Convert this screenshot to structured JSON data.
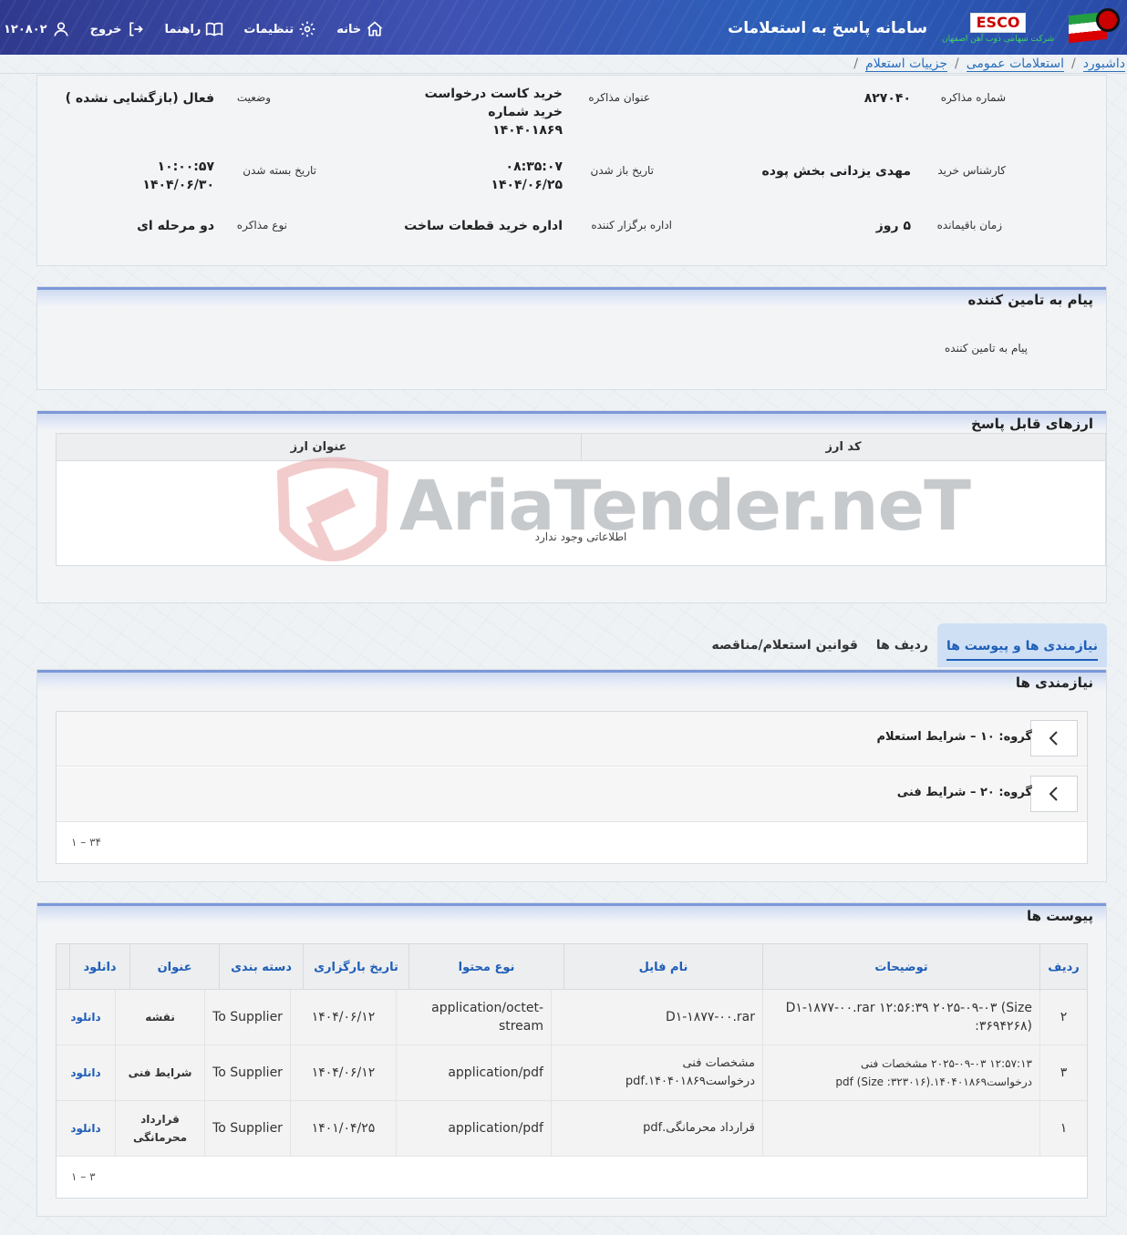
{
  "header": {
    "system_title": "سامانه پاسخ به استعلامات",
    "brand_name": "ESCO",
    "brand_sub": "شرکت سهامی ذوب آهن اصفهان",
    "nav": {
      "home": "خانه",
      "settings": "تنظیمات",
      "guide": "راهنما",
      "logout": "خروج",
      "user_id": "۱۲۰۸۰۲"
    }
  },
  "breadcrumb": {
    "items": [
      "داشبورد",
      "استعلامات عمومی",
      "جزییات استعلام"
    ],
    "separator": "/"
  },
  "details": {
    "negotiation_number_label": "شماره مذاکره",
    "negotiation_number": "۸۲۷۰۴۰",
    "negotiation_title_label": "عنوان مذاکره",
    "negotiation_title": "خرید کاست درخواست خرید شماره ۱۴۰۴۰۱۸۶۹",
    "status_label": "وضعیت",
    "status": "فعال (بازگشایی نشده )",
    "buyer_label": "کارشناس خرید",
    "buyer": "مهدی یزدانی بخش پوده",
    "open_date_label": "تاریخ باز شدن",
    "open_time": "۰۸:۳۵:۰۷",
    "open_date": "۱۴۰۴/۰۶/۲۵",
    "close_date_label": "تاریخ بسته شدن",
    "close_time": "۱۰:۰۰:۵۷",
    "close_date": "۱۴۰۴/۰۶/۳۰",
    "remaining_label": "زمان باقیمانده",
    "remaining": "۵ روز",
    "organizer_label": "اداره برگزار کننده",
    "organizer": "اداره خرید قطعات ساخت",
    "type_label": "نوع مذاکره",
    "type": "دو مرحله ای"
  },
  "supplier_message": {
    "title": "پیام به تامین کننده",
    "label": "پیام به تامین کننده"
  },
  "currencies": {
    "title": "ارزهای قابل پاسخ",
    "col_code": "کد ارز",
    "col_title": "عنوان ارز",
    "empty": "اطلاعاتی وجود ندارد"
  },
  "tabs": [
    "نیازمندی ها و پیوست ها",
    "ردیف ها",
    "قوانین استعلام/مناقصه"
  ],
  "requirements": {
    "title": "نیازمندی ها",
    "groups": [
      "گروه: ۱۰ – شرایط استعلام",
      "گروه: ۲۰ – شرایط فنی"
    ],
    "pager": "۱ – ۳۴"
  },
  "attachments": {
    "title": "پیوست ها",
    "columns": [
      "ردیف",
      "توضیحات",
      "نام فایل",
      "نوع محتوا",
      "تاریخ بارگزاری",
      "دسته بندی",
      "عنوان",
      "دانلود"
    ],
    "rows": [
      {
        "row": "۲",
        "desc": "D۱-۱۸۷۷-۰۰.rar ۱۲:۵۶:۳۹ ۲۰۲۵-۰۹-۰۳ (Size :۳۶۹۴۲۶۸)",
        "file": "D۱-۱۸۷۷-۰۰.rar",
        "type": "application/octet-stream",
        "date": "۱۴۰۴/۰۶/۱۲",
        "category": "To Supplier",
        "title": "نقشه",
        "download": "دانلود"
      },
      {
        "row": "۳",
        "desc": "۱۲:۵۷:۱۳ ۲۰۲۵-۰۹-۰۳ مشخصات فنی درخواست۱۴۰۴۰۱۸۶۹.pdf (Size :۳۲۳۰۱۶)",
        "file": "مشخصات فنی درخواست۱۴۰۴۰۱۸۶۹.pdf",
        "type": "application/pdf",
        "date": "۱۴۰۴/۰۶/۱۲",
        "category": "To Supplier",
        "title": "شرایط فنی",
        "download": "دانلود"
      },
      {
        "row": "۱",
        "desc": "",
        "file": "قرارداد محرمانگی.pdf",
        "type": "application/pdf",
        "date": "۱۴۰۱/۰۴/۲۵",
        "category": "To Supplier",
        "title": "قرارداد محرمانگی",
        "download": "دانلود"
      }
    ],
    "pager": "۱ – ۳"
  },
  "watermark": "AriaTender.neT"
}
